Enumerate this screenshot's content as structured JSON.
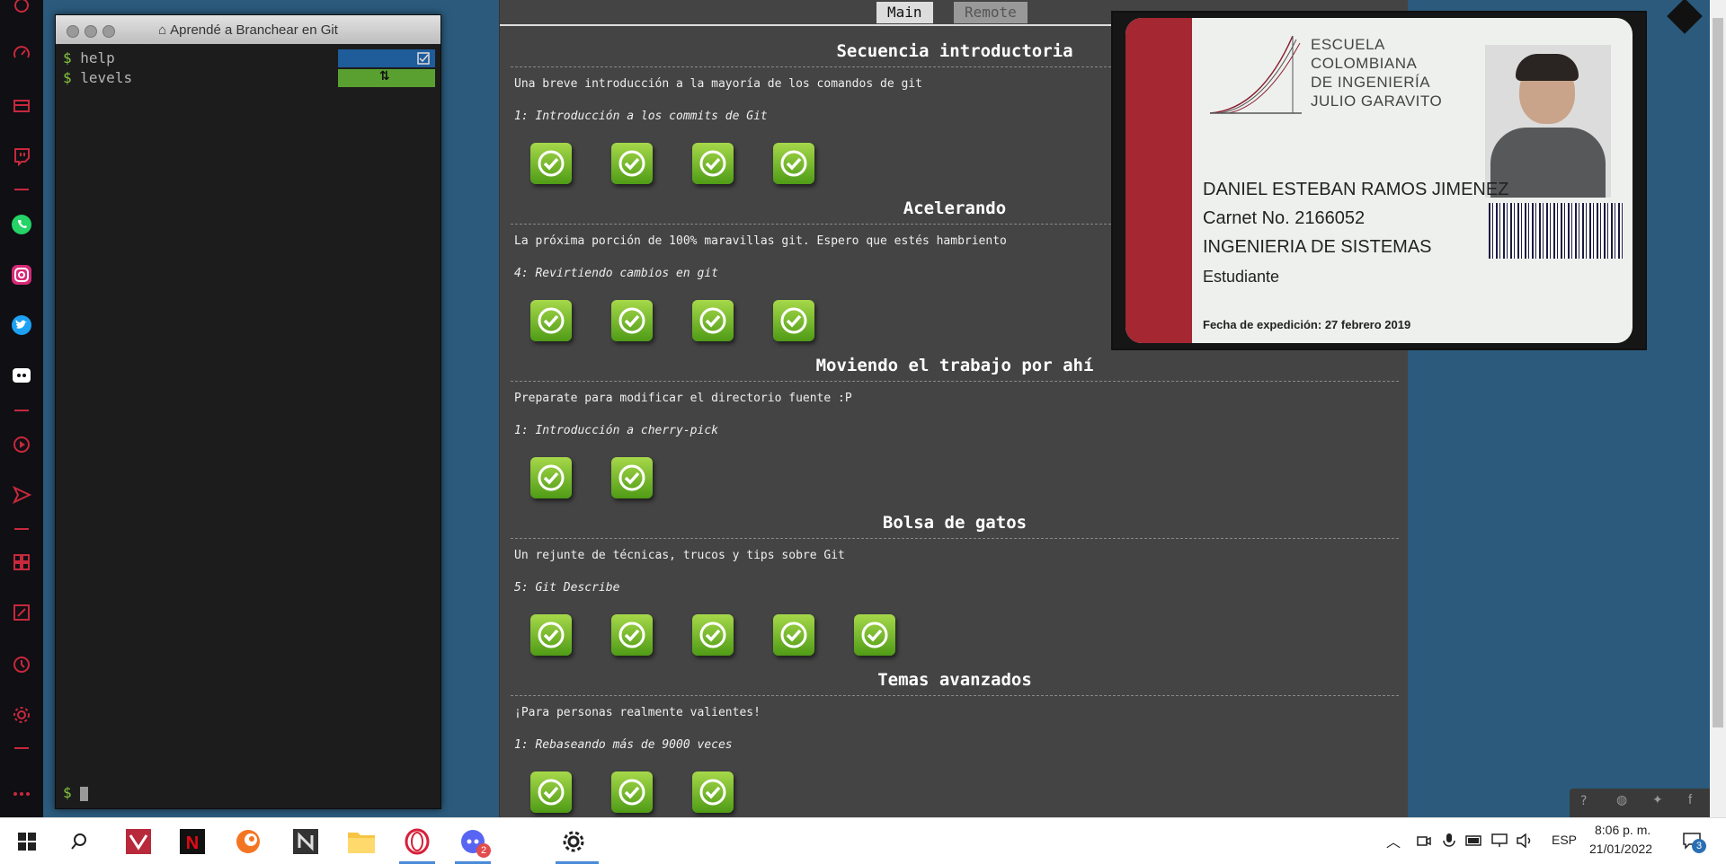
{
  "terminal": {
    "title": "Aprendé a Branchear en Git",
    "lines": [
      {
        "prompt": "$",
        "cmd": "help"
      },
      {
        "prompt": "$",
        "cmd": "levels"
      },
      {
        "prompt": "$",
        "cmd": ""
      }
    ]
  },
  "tabs": {
    "main": "Main",
    "remote": "Remote"
  },
  "sections": [
    {
      "title": "Secuencia introductoria",
      "desc": "Una breve introducción a la mayoría de los comandos de git",
      "level": "1: Introducción a los commits de Git",
      "completed": 4
    },
    {
      "title": "Acelerando",
      "desc": "La próxima porción de 100% maravillas git. Espero que estés hambriento",
      "level": "4: Revirtiendo cambios en git",
      "completed": 4
    },
    {
      "title": "Moviendo el trabajo por ahí",
      "desc": "Preparate para modificar el directorio fuente :P",
      "level": "1: Introducción a cherry-pick",
      "completed": 2
    },
    {
      "title": "Bolsa de gatos",
      "desc": "Un rejunte de técnicas, trucos y tips sobre Git",
      "level": "5: Git Describe",
      "completed": 5
    },
    {
      "title": "Temas avanzados",
      "desc": "¡Para personas realmente valientes!",
      "level": "1: Rebaseando más de 9000 veces",
      "completed": 3
    }
  ],
  "id_card": {
    "school": [
      "ESCUELA",
      "COLOMBIANA",
      "DE INGENIERÍA",
      "JULIO GARAVITO"
    ],
    "name": "DANIEL ESTEBAN RAMOS JIMENEZ",
    "carnet": "Carnet No. 2166052",
    "program": "INGENIERIA DE SISTEMAS",
    "role": "Estudiante",
    "issued": "Fecha de expedición: 27 febrero 2019"
  },
  "taskbar": {
    "language": "ESP",
    "time": "8:06 p. m.",
    "date": "21/01/2022",
    "notifications": "3",
    "app_badge": "2"
  },
  "colors": {
    "accent_red": "#c8283c",
    "check_green": "#7cc12c",
    "panel_bg": "#444444",
    "desktop_bg": "#2b5a7c"
  }
}
